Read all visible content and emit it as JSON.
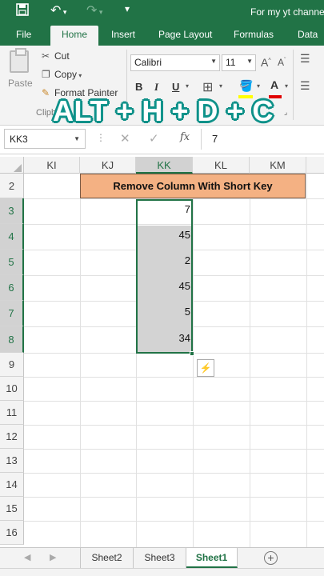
{
  "titlebar": {
    "title": "For my yt channe",
    "save_icon": "save-icon",
    "undo_icon": "undo-icon",
    "redo_icon": "redo-icon",
    "customize_icon": "customize-icon"
  },
  "tabs": [
    "File",
    "Home",
    "Insert",
    "Page Layout",
    "Formulas",
    "Data"
  ],
  "active_tab": "Home",
  "ribbon": {
    "paste_label": "Paste",
    "cut_label": "Cut",
    "copy_label": "Copy",
    "format_painter_label": "Format Painter",
    "clipboard_group_label": "Clipb",
    "font_name": "Calibri",
    "font_size": "11",
    "bold": "B",
    "italic": "I",
    "underline": "U"
  },
  "overlay_text": "ALT + H + D + C",
  "formula_bar": {
    "name_box": "KK3",
    "fx_label": "fx",
    "value": "7"
  },
  "columns": [
    "KI",
    "KJ",
    "KK",
    "KL",
    "KM"
  ],
  "selected_column": "KK",
  "rows": [
    "2",
    "3",
    "4",
    "5",
    "6",
    "7",
    "8",
    "9",
    "10",
    "11",
    "12",
    "13",
    "14",
    "15",
    "16"
  ],
  "title_cell": "Remove Column With Short Key",
  "values": [
    "7",
    "45",
    "2",
    "45",
    "5",
    "34"
  ],
  "sheets": [
    "Sheet2",
    "Sheet3",
    "Sheet1"
  ],
  "active_sheet": "Sheet1",
  "accent_color": "#217346",
  "title_fill_color": "#f4b183"
}
